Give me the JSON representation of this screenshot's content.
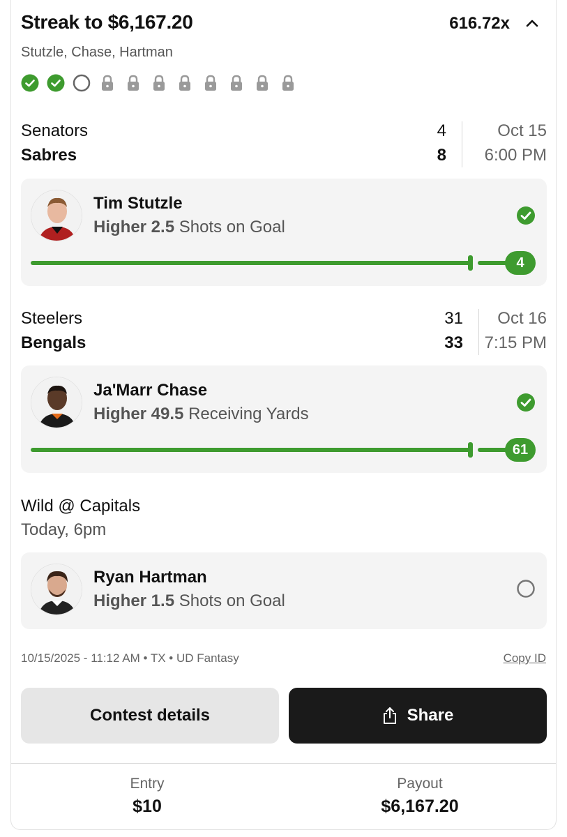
{
  "header": {
    "title": "Streak to $6,167.20",
    "multiplier": "616.72x",
    "players": "Stutzle, Chase, Hartman"
  },
  "progress": [
    "won",
    "won",
    "pending",
    "locked",
    "locked",
    "locked",
    "locked",
    "locked",
    "locked",
    "locked",
    "locked"
  ],
  "games": [
    {
      "team1": "Senators",
      "team2": "Sabres",
      "score1": "4",
      "score2": "8",
      "date": "Oct 15",
      "time": "6:00 PM"
    },
    {
      "team1": "Steelers",
      "team2": "Bengals",
      "score1": "31",
      "score2": "33",
      "date": "Oct 16",
      "time": "7:15 PM"
    }
  ],
  "picks": [
    {
      "name": "Tim Stutzle",
      "direction_line": "Higher 2.5",
      "stat": "Shots on Goal",
      "result": "4",
      "status": "won"
    },
    {
      "name": "Ja'Marr Chase",
      "direction_line": "Higher 49.5",
      "stat": "Receiving Yards",
      "result": "61",
      "status": "won"
    },
    {
      "name": "Ryan Hartman",
      "direction_line": "Higher 1.5",
      "stat": "Shots on Goal",
      "status": "pending"
    }
  ],
  "upcoming": {
    "matchup": "Wild @ Capitals",
    "time": "Today, 6pm"
  },
  "meta": {
    "info": "10/15/2025 - 11:12 AM • TX • UD Fantasy",
    "copy_id": "Copy ID"
  },
  "buttons": {
    "details": "Contest details",
    "share": "Share"
  },
  "footer": {
    "entry_label": "Entry",
    "entry_value": "$10",
    "payout_label": "Payout",
    "payout_value": "$6,167.20"
  },
  "colors": {
    "accent_green": "#3e9b2f",
    "dark_button": "#1a1a1a"
  },
  "icons": [
    "chevron-up-icon",
    "check-circle-icon",
    "empty-circle-icon",
    "lock-icon",
    "share-icon"
  ]
}
